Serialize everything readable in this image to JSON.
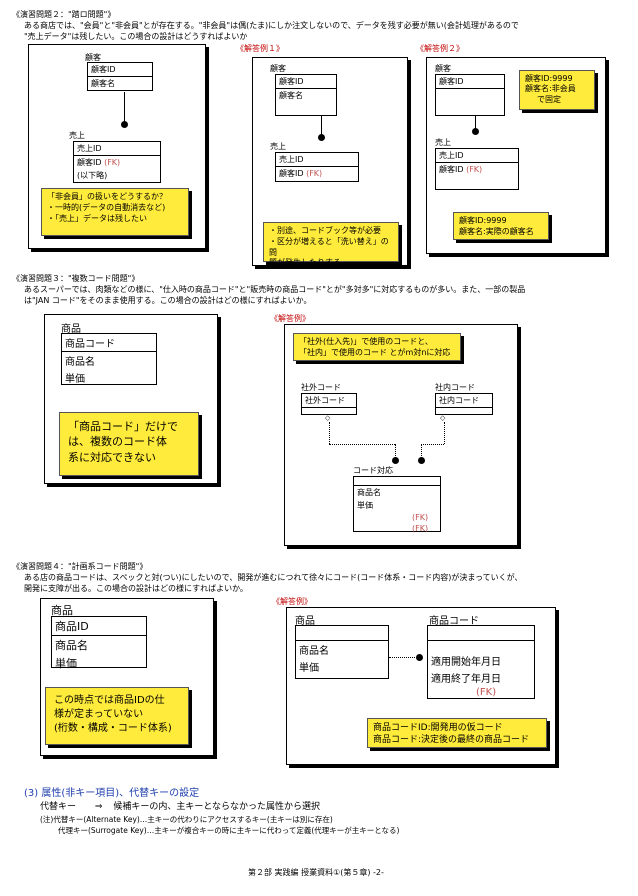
{
  "ex2": {
    "title": "《演習問題２：\"踏ロ問題\"》",
    "desc1": "ある商店では、\"会員\"と\"非会員\"とが存在する。\"非会員\"は偶(たま)にしか注文しないので、データを残す必要が無い(会計処理があるので",
    "desc2": "\"売上データ\"は残したい。この場合の設計はどうすればよいか",
    "q": {
      "cust_title": "顧客",
      "cust_pk": "顧客ID",
      "cust_row": "顧客名",
      "sale_title": "売上",
      "sale_pk": "売上ID",
      "sale_row1": "顧客ID",
      "sale_fk": "(FK)",
      "sale_row2": "(以下略)",
      "note1": "「非会員」の扱いをどうするか？",
      "note2": "・一時的(データの自動消去など)",
      "note3": "・「売上」データは残したい"
    },
    "a1": {
      "label": "《解答例１》",
      "cust_title": "顧客",
      "cust_pk": "顧客ID",
      "cust_row": "顧客名",
      "sale_title": "売上",
      "sale_pk": "売上ID",
      "sale_row": "顧客ID",
      "sale_fk": "(FK)",
      "note1": "・別途、コードブック等が必要",
      "note2": "・区分が増えると「洗い替え」の問",
      "note3": "題が発生したりする"
    },
    "a2": {
      "label": "《解答例２》",
      "cust_title": "顧客",
      "cust_pk": "顧客ID",
      "sale_title": "売上",
      "sale_pk": "売上ID",
      "sale_row": "顧客ID",
      "sale_fk": "(FK)",
      "note1a": "顧客ID:9999",
      "note1b": "顧客名:非会員",
      "note1c": "で固定",
      "note2a": "顧客ID:9999",
      "note2b": "顧客名:実際の顧客名"
    }
  },
  "ex3": {
    "title": "《演習問題３：\"複数コード問題\"》",
    "desc1": "あるスーパーでは、肉類などの様に、\"仕入時の商品コード\"と\"販売時の商品コード\"とが\"多対多\"に対応するものが多い。また、一部の製品",
    "desc2": "は\"JAN コード\"をそのまま使用する。この場合の設計はどの様にすればよいか。",
    "q": {
      "title": "商品",
      "pk": "商品コード",
      "row1": "商品名",
      "row2": "単価",
      "note1": "「商品コード」だけで",
      "note2": "は、複数のコード体",
      "note3": "系に対応できない"
    },
    "a": {
      "label": "《解答例》",
      "note1": "「社外(仕入先)」で使用のコードと、",
      "note2": "「社内」で使用のコード とがm対nに対応",
      "ext_title": "社外コード",
      "ext_pk": "社外コード",
      "int_title": "社内コード",
      "int_pk": "社内コード",
      "map_title": "コード対応",
      "map_row1": "商品名",
      "map_row2": "単価",
      "fk1": "(FK)",
      "fk2": "(FK)"
    }
  },
  "ex4": {
    "title": "《演習問題４：\"計画系コード問題\"》",
    "desc1": "ある店の商品コードは、スペックと対(つい)にしたいので、開発が進むにつれて徐々にコード(コード体系・コード内容)が決まっていくが、",
    "desc2": "開発に支障が出る。この場合の設計はどの様にすればよいか。",
    "q": {
      "title": "商品",
      "pk": "商品ID",
      "row1": "商品名",
      "row2": "単価",
      "note1": "この時点では商品IDの仕",
      "note2": "様が定まっていない",
      "note3": "(桁数・構成・コード体系)"
    },
    "a": {
      "label": "《解答例》",
      "prod_title": "商品",
      "prod_row1": "商品名",
      "prod_row2": "単価",
      "code_title": "商品コード",
      "code_row1": "適用開始年月日",
      "code_row2": "適用終了年月日",
      "code_fk": "(FK)",
      "note1": "商品コードID:開発用の仮コード",
      "note2": "商品コード:決定後の最終の商品コード"
    }
  },
  "section3": {
    "heading": "(3)  属性(非キー項目)、代替キーの設定",
    "line1a": "代替キー",
    "arrow": "⇒",
    "line1b": "候補キーの内、主キーとならなかった属性から選択",
    "line2": "(注)代替キー(Alternate Key)…主キーの代わりにアクセスするキー(主キーは別に存在)",
    "line3": "代理キー(Surrogate Key)…主キーが複合キーの時に主キーに代わって定義(代理キーが主キーとなる)"
  },
  "footer": "第２部 実践編 授業資料①(第５章) -2-"
}
